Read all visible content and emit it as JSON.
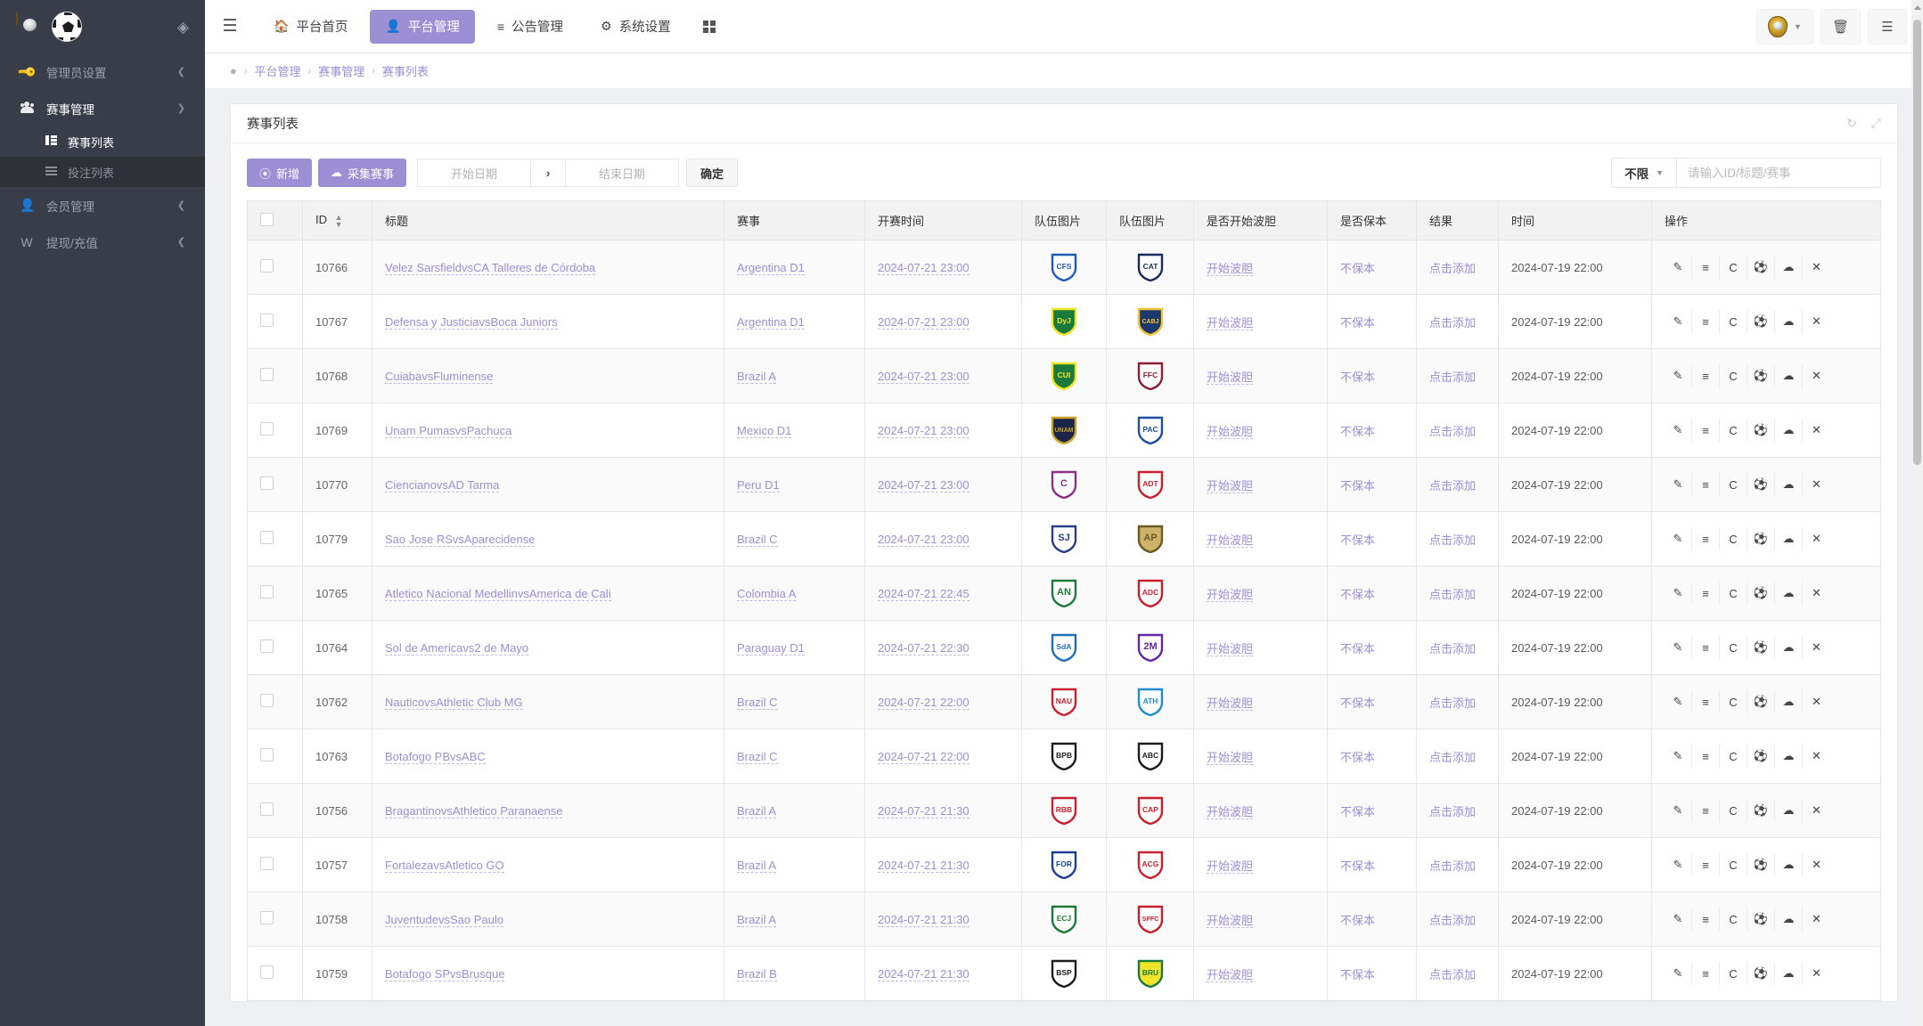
{
  "brand": {
    "logo_icon": "crest-logo",
    "ball_icon": "soccer-ball-icon",
    "drop_icon": "water-drop-icon"
  },
  "sidebar": {
    "groups": [
      {
        "label": "管理员设置",
        "icon": "key-icon",
        "active": false,
        "caret": "chevron-left-icon"
      },
      {
        "label": "赛事管理",
        "icon": "people-icon",
        "active": true,
        "caret": "chevron-down-icon"
      },
      {
        "label": "会员管理",
        "icon": "user-icon",
        "active": false,
        "caret": "chevron-left-icon"
      },
      {
        "label": "提现/充值",
        "icon": "wallet-icon",
        "active": false,
        "caret": "chevron-left-icon"
      }
    ],
    "subitems": [
      {
        "label": "赛事列表",
        "icon": "grid-icon",
        "active": true
      },
      {
        "label": "投注列表",
        "icon": "list-icon",
        "active": false
      }
    ]
  },
  "topnav": {
    "menu_icon": "hamburger-icon",
    "items": [
      {
        "label": "平台首页",
        "icon": "home-icon",
        "active": false
      },
      {
        "label": "平台管理",
        "icon": "user-icon",
        "active": true
      },
      {
        "label": "公告管理",
        "icon": "announcement-icon",
        "active": false
      },
      {
        "label": "系统设置",
        "icon": "gear-icon",
        "active": false
      }
    ],
    "apps_icon": "apps-grid-icon",
    "right_buttons": [
      {
        "name": "user-avatar-menu",
        "icon": "avatar-icon",
        "caret": "▾"
      },
      {
        "name": "clear-cache-button",
        "icon": "trash-icon"
      },
      {
        "name": "panel-toggle-button",
        "icon": "panel-icon"
      }
    ]
  },
  "breadcrumb": {
    "pin_icon": "location-pin-icon",
    "items": [
      "平台管理",
      "赛事管理",
      "赛事列表"
    ]
  },
  "card": {
    "title": "赛事列表",
    "tools": [
      {
        "name": "refresh-icon",
        "glyph": "↻"
      },
      {
        "name": "fullscreen-icon",
        "glyph": "⤢"
      }
    ]
  },
  "toolbar": {
    "add_label": "新增",
    "add_icon": "plus-circle-icon",
    "collect_label": "采集赛事",
    "collect_icon": "cloud-download-icon",
    "start_date_placeholder": "开始日期",
    "range_arrow": "›",
    "end_date_placeholder": "结束日期",
    "confirm_label": "确定",
    "filter_label": "不限",
    "filter_caret": "▾",
    "search_placeholder": "请输入ID/标题/赛事",
    "search_value": ""
  },
  "table": {
    "columns": [
      "",
      "ID",
      "标题",
      "赛事",
      "开赛时间",
      "队伍图片",
      "队伍图片",
      "是否开始波胆",
      "是否保本",
      "结果",
      "时间",
      "操作"
    ],
    "op_icons": [
      {
        "name": "edit-icon",
        "glyph": "✎"
      },
      {
        "name": "list-icon",
        "glyph": "≡"
      },
      {
        "name": "refresh-icon",
        "glyph": "C"
      },
      {
        "name": "soccer-ball-icon",
        "glyph": "⚽"
      },
      {
        "name": "cloud-upload-icon",
        "glyph": "☁"
      },
      {
        "name": "close-icon",
        "glyph": "✕"
      }
    ],
    "rows": [
      {
        "id": "10766",
        "title": "Velez SarsfieldvsCA Talleres de Córdoba",
        "league": "Argentina D1",
        "kickoff": "2024-07-21 23:00",
        "home_logo": "velez-sarsfield-crest",
        "away_logo": "talleres-crest",
        "bodan": "开始波胆",
        "baoben": "不保本",
        "result": "点击添加",
        "time": "2024-07-19 22:00"
      },
      {
        "id": "10767",
        "title": "Defensa y JusticiavsBoca Juniors",
        "league": "Argentina D1",
        "kickoff": "2024-07-21 23:00",
        "home_logo": "defensa-y-justicia-crest",
        "away_logo": "boca-juniors-crest",
        "bodan": "开始波胆",
        "baoben": "不保本",
        "result": "点击添加",
        "time": "2024-07-19 22:00"
      },
      {
        "id": "10768",
        "title": "CuiabavsFluminense",
        "league": "Brazil A",
        "kickoff": "2024-07-21 23:00",
        "home_logo": "cuiaba-crest",
        "away_logo": "fluminense-crest",
        "bodan": "开始波胆",
        "baoben": "不保本",
        "result": "点击添加",
        "time": "2024-07-19 22:00"
      },
      {
        "id": "10769",
        "title": "Unam PumasvsPachuca",
        "league": "Mexico D1",
        "kickoff": "2024-07-21 23:00",
        "home_logo": "unam-pumas-crest",
        "away_logo": "pachuca-crest",
        "bodan": "开始波胆",
        "baoben": "不保本",
        "result": "点击添加",
        "time": "2024-07-19 22:00"
      },
      {
        "id": "10770",
        "title": "CiencianovsAD Tarma",
        "league": "Peru D1",
        "kickoff": "2024-07-21 23:00",
        "home_logo": "cienciano-crest",
        "away_logo": "ad-tarma-crest",
        "bodan": "开始波胆",
        "baoben": "不保本",
        "result": "点击添加",
        "time": "2024-07-19 22:00"
      },
      {
        "id": "10779",
        "title": "Sao Jose RSvsAparecidense",
        "league": "Brazil C",
        "kickoff": "2024-07-21 23:00",
        "home_logo": "sao-jose-rs-crest",
        "away_logo": "aparecidense-crest",
        "bodan": "开始波胆",
        "baoben": "不保本",
        "result": "点击添加",
        "time": "2024-07-19 22:00"
      },
      {
        "id": "10765",
        "title": "Atletico Nacional MedellinvsAmerica de Cali",
        "league": "Colombia A",
        "kickoff": "2024-07-21 22:45",
        "home_logo": "atletico-nacional-crest",
        "away_logo": "america-de-cali-crest",
        "bodan": "开始波胆",
        "baoben": "不保本",
        "result": "点击添加",
        "time": "2024-07-19 22:00"
      },
      {
        "id": "10764",
        "title": "Sol de Americavs2 de Mayo",
        "league": "Paraguay D1",
        "kickoff": "2024-07-21 22:30",
        "home_logo": "sol-de-america-crest",
        "away_logo": "2-de-mayo-crest",
        "bodan": "开始波胆",
        "baoben": "不保本",
        "result": "点击添加",
        "time": "2024-07-19 22:00"
      },
      {
        "id": "10762",
        "title": "NauticovsAthletic Club MG",
        "league": "Brazil C",
        "kickoff": "2024-07-21 22:00",
        "home_logo": "nautico-crest",
        "away_logo": "athletic-club-mg-crest",
        "bodan": "开始波胆",
        "baoben": "不保本",
        "result": "点击添加",
        "time": "2024-07-19 22:00"
      },
      {
        "id": "10763",
        "title": "Botafogo PBvsABC",
        "league": "Brazil C",
        "kickoff": "2024-07-21 22:00",
        "home_logo": "botafogo-pb-crest",
        "away_logo": "abc-crest",
        "bodan": "开始波胆",
        "baoben": "不保本",
        "result": "点击添加",
        "time": "2024-07-19 22:00"
      },
      {
        "id": "10756",
        "title": "BragantinovsAthletico Paranaense",
        "league": "Brazil A",
        "kickoff": "2024-07-21 21:30",
        "home_logo": "bragantino-crest",
        "away_logo": "athletico-paranaense-crest",
        "bodan": "开始波胆",
        "baoben": "不保本",
        "result": "点击添加",
        "time": "2024-07-19 22:00"
      },
      {
        "id": "10757",
        "title": "FortalezavsAtletico GO",
        "league": "Brazil A",
        "kickoff": "2024-07-21 21:30",
        "home_logo": "fortaleza-crest",
        "away_logo": "atletico-go-crest",
        "bodan": "开始波胆",
        "baoben": "不保本",
        "result": "点击添加",
        "time": "2024-07-19 22:00"
      },
      {
        "id": "10758",
        "title": "JuventudevsSao Paulo",
        "league": "Brazil A",
        "kickoff": "2024-07-21 21:30",
        "home_logo": "juventude-crest",
        "away_logo": "sao-paulo-crest",
        "bodan": "开始波胆",
        "baoben": "不保本",
        "result": "点击添加",
        "time": "2024-07-19 22:00"
      },
      {
        "id": "10759",
        "title": "Botafogo SPvsBrusque",
        "league": "Brazil B",
        "kickoff": "2024-07-21 21:30",
        "home_logo": "botafogo-sp-crest",
        "away_logo": "brusque-crest",
        "bodan": "开始波胆",
        "baoben": "不保本",
        "result": "点击添加",
        "time": "2024-07-19 22:00"
      }
    ]
  },
  "colors": {
    "accent": "#9d8fd4",
    "sidebar_bg": "#393D49",
    "sidebar_sub_bg": "#2E3138",
    "link": "#9c8fd3"
  }
}
